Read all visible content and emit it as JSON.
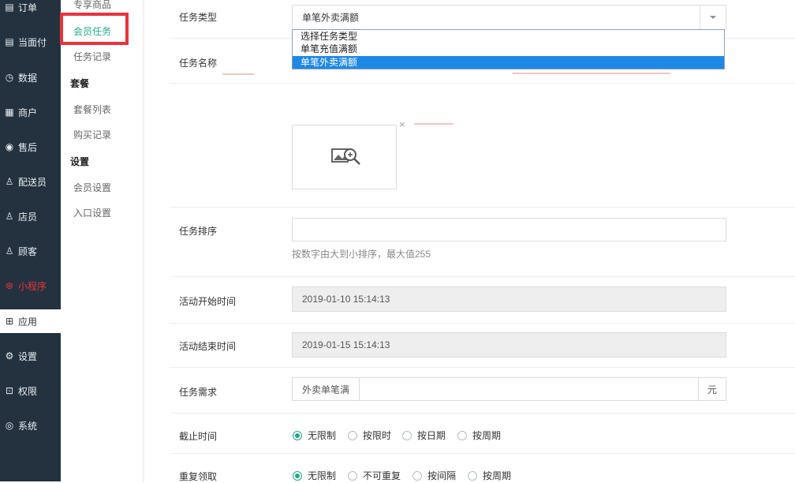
{
  "sidebar": {
    "items": [
      {
        "label": "订单",
        "icon": "order-icon"
      },
      {
        "label": "当面付",
        "icon": "pay-icon"
      },
      {
        "label": "数据",
        "icon": "data-icon"
      },
      {
        "label": "商户",
        "icon": "store-icon"
      },
      {
        "label": "售后",
        "icon": "after-sale-icon"
      },
      {
        "label": "配送员",
        "icon": "courier-icon"
      },
      {
        "label": "店员",
        "icon": "clerk-icon"
      },
      {
        "label": "顾客",
        "icon": "customer-icon"
      },
      {
        "label": "小程序",
        "icon": "miniprogram-icon"
      },
      {
        "label": "应用",
        "icon": "apps-icon"
      },
      {
        "label": "设置",
        "icon": "gear-icon"
      },
      {
        "label": "权限",
        "icon": "lock-icon"
      },
      {
        "label": "系统",
        "icon": "system-icon"
      }
    ],
    "active": "应用",
    "accent": "#e8343c"
  },
  "subnav": {
    "items": [
      "专享商品",
      "会员任务",
      "任务记录"
    ],
    "group_package": "套餐",
    "package_items": [
      "套餐列表",
      "购买记录"
    ],
    "group_settings": "设置",
    "settings_items": [
      "会员设置",
      "入口设置"
    ],
    "active": "会员任务",
    "active_color": "#23a68a"
  },
  "form": {
    "task_type": {
      "label": "任务类型",
      "value": "单笔外卖满额",
      "options": [
        "选择任务类型",
        "单笔充值满额",
        "单笔外卖满额"
      ],
      "selected_index": 2
    },
    "task_name": {
      "label": "任务名称"
    },
    "task_sort": {
      "label": "任务排序",
      "value": "",
      "hint": "按数字由大到小排序，最大值255"
    },
    "start_time": {
      "label": "活动开始时间",
      "value": "2019-01-10 15:14:13"
    },
    "end_time": {
      "label": "活动结束时间",
      "value": "2019-01-15 15:14:13"
    },
    "requirement": {
      "label": "任务需求",
      "prefix": "外卖单笔满",
      "value": "",
      "suffix": "元"
    },
    "deadline": {
      "label": "截止时间",
      "options": [
        "无限制",
        "按限时",
        "按日期",
        "按周期"
      ],
      "selected": 0
    },
    "repeat": {
      "label": "重复领取",
      "options": [
        "无限制",
        "不可重复",
        "按间隔",
        "按周期"
      ],
      "selected": 0
    }
  }
}
